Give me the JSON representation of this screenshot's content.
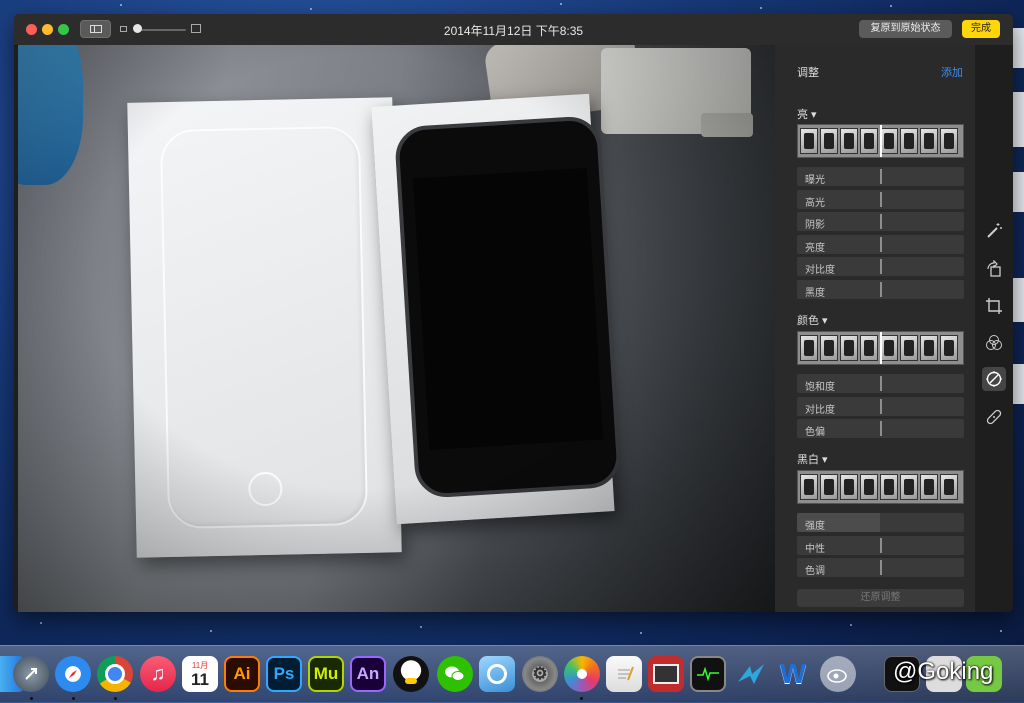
{
  "window": {
    "title": "2014年11月12日 下午8:35",
    "revert_label": "复原到原始状态",
    "done_label": "完成",
    "colors": {
      "done": "#ffd60a",
      "accent": "#3d8fef"
    }
  },
  "panel": {
    "title": "调整",
    "add_label": "添加",
    "sections": [
      {
        "title": "亮 ▾",
        "sliders": [
          "曝光",
          "高光",
          "阴影",
          "亮度",
          "对比度",
          "黑度"
        ]
      },
      {
        "title": "颜色 ▾",
        "sliders": [
          "饱和度",
          "对比度",
          "色偏"
        ]
      },
      {
        "title": "黑白 ▾",
        "sliders": [
          "强度",
          "中性",
          "色调"
        ]
      }
    ],
    "reset_label": "还原调整"
  },
  "tools": [
    "magic-wand-icon",
    "rotate-icon",
    "crop-icon",
    "filters-icon",
    "adjust-icon",
    "retouch-icon"
  ],
  "dock": {
    "apps": [
      "Finder",
      "Launchpad",
      "Safari",
      "Chrome",
      "iTunes",
      "Calendar",
      "Illustrator",
      "Photoshop",
      "Muse",
      "Animate",
      "QQ",
      "WeChat",
      "Preview",
      "System Preferences",
      "Photos",
      "TextEdit",
      "Photo Booth",
      "Activity Monitor",
      "Lark",
      "Word"
    ],
    "calendar_month": "11月",
    "calendar_day": "11",
    "ai_label": "Ai",
    "ps_label": "Ps",
    "mu_label": "Mu",
    "an_label": "An",
    "w_label": "W"
  },
  "watermark": "@Goking"
}
